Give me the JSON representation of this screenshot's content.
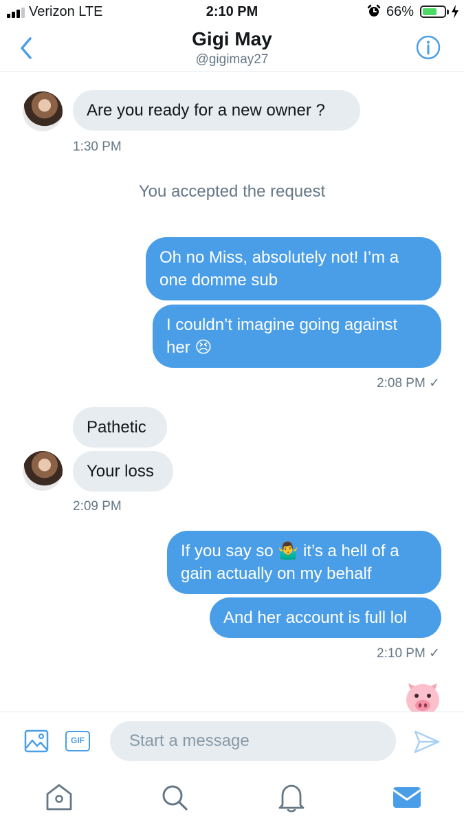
{
  "status_bar": {
    "carrier": "Verizon  LTE",
    "time": "2:10 PM",
    "battery_percent_text": "66%",
    "battery_level": 0.66,
    "signal_bars": 3,
    "signal_total": 4,
    "icons": [
      "signal-icon",
      "alarm-icon",
      "battery-icon",
      "charging-icon"
    ]
  },
  "header": {
    "title": "Gigi May",
    "handle": "@gigimay27",
    "icons": [
      "back-chevron-icon",
      "info-icon"
    ]
  },
  "conversation": {
    "msg1": "Are you ready for a new owner ?",
    "ts1": "1:30 PM",
    "system_note": "You accepted the request",
    "msg2": "Oh no Miss, absolutely not! I’m a\none domme sub",
    "msg3_text": "I couldn’t imagine going against\nher ",
    "msg3_emoji": "😣",
    "ts2": "2:08 PM",
    "msg4": "Pathetic",
    "msg5": "Your loss",
    "ts3": "2:09 PM",
    "msg6_part1": "If you say so ",
    "msg6_emoji": "🤷‍♂️",
    "msg6_part2": " it’s a hell of a\ngain actually on my behalf",
    "msg7": "And her account is full lol",
    "ts4": "2:10 PM",
    "read_receipt": "✓",
    "last_emoji_icon": "pig-face-icon"
  },
  "composer": {
    "placeholder": "Start a message",
    "gif_label": "GIF",
    "icons": [
      "image-icon",
      "gif-icon",
      "send-icon"
    ]
  },
  "tabbar": {
    "icons": [
      "home-icon",
      "search-icon",
      "notifications-bell-icon",
      "messages-envelope-icon"
    ],
    "active": "messages",
    "accent_color": "#4a9ee8",
    "inactive_color": "#657786"
  },
  "colors": {
    "outgoing_bubble": "#4a9ee8",
    "incoming_bubble": "#e6ecf0",
    "secondary_text": "#657786"
  }
}
